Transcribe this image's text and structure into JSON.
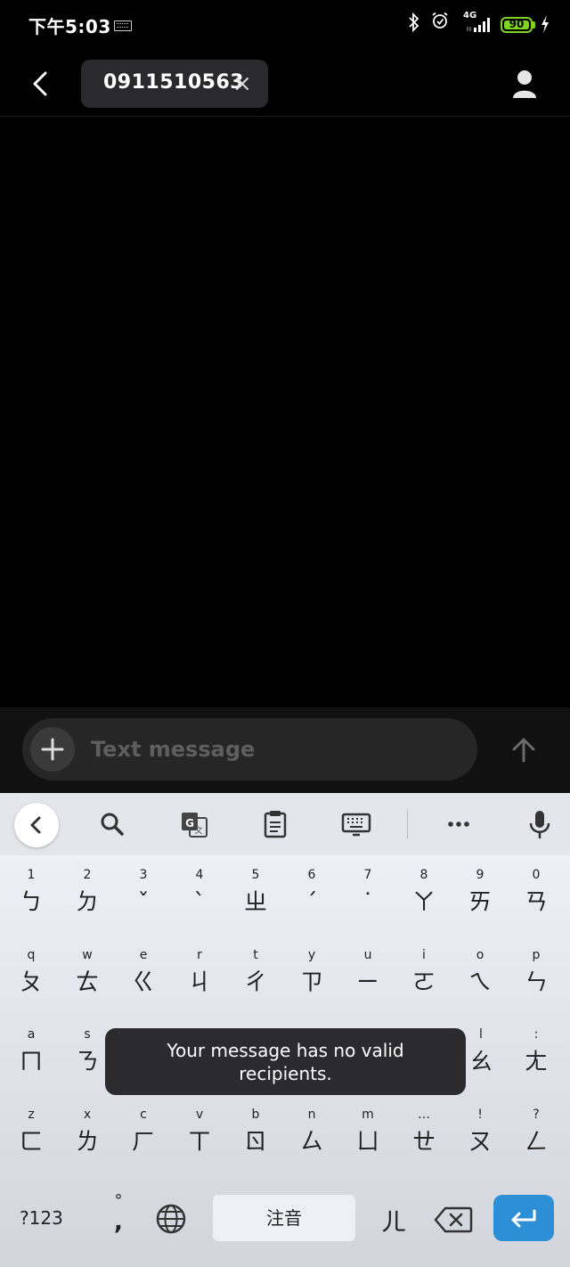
{
  "status_bar": {
    "time": "下午5:03",
    "network": "4G",
    "battery": "90"
  },
  "header": {
    "recipient": "0911510563"
  },
  "compose": {
    "placeholder": "Text message"
  },
  "keyboard": {
    "row1": [
      {
        "hint": "1",
        "main": "ㄅ"
      },
      {
        "hint": "2",
        "main": "ㄉ"
      },
      {
        "hint": "3",
        "main": "ˇ"
      },
      {
        "hint": "4",
        "main": "ˋ"
      },
      {
        "hint": "5",
        "main": "ㄓ"
      },
      {
        "hint": "6",
        "main": "ˊ"
      },
      {
        "hint": "7",
        "main": "˙"
      },
      {
        "hint": "8",
        "main": "ㄚ"
      },
      {
        "hint": "9",
        "main": "ㄞ"
      },
      {
        "hint": "0",
        "main": "ㄢ"
      }
    ],
    "row2": [
      {
        "hint": "q",
        "main": "ㄆ"
      },
      {
        "hint": "w",
        "main": "ㄊ"
      },
      {
        "hint": "e",
        "main": "ㄍ"
      },
      {
        "hint": "r",
        "main": "ㄐ"
      },
      {
        "hint": "t",
        "main": "ㄔ"
      },
      {
        "hint": "y",
        "main": "ㄗ"
      },
      {
        "hint": "u",
        "main": "ㄧ"
      },
      {
        "hint": "i",
        "main": "ㄛ"
      },
      {
        "hint": "o",
        "main": "ㄟ"
      },
      {
        "hint": "p",
        "main": "ㄣ"
      }
    ],
    "row3": [
      {
        "hint": "a",
        "main": "ㄇ"
      },
      {
        "hint": "s",
        "main": "ㄋ"
      },
      {
        "hint": "l",
        "main": "ㄠ"
      },
      {
        "hint": ":",
        "main": "ㄤ"
      }
    ],
    "row4": [
      {
        "hint": "z",
        "main": "ㄈ"
      },
      {
        "hint": "x",
        "main": "ㄌ"
      },
      {
        "hint": "c",
        "main": "ㄏ"
      },
      {
        "hint": "v",
        "main": "ㄒ"
      },
      {
        "hint": "b",
        "main": "ㄖ"
      },
      {
        "hint": "n",
        "main": "ㄙ"
      },
      {
        "hint": "m",
        "main": "ㄩ"
      },
      {
        "hint": "…",
        "main": "ㄝ"
      },
      {
        "hint": "!",
        "main": "ㄡ"
      },
      {
        "hint": "?",
        "main": "ㄥ"
      }
    ],
    "sym_label": "?123",
    "punct_top": "°",
    "punct_bottom": ",",
    "space_label": "注音",
    "er_label": "ㄦ",
    "enter_color": "#2d8fd6"
  },
  "toast": {
    "line1": "Your message has no valid",
    "line2": "recipients."
  },
  "icons": [
    "back-arrow-icon",
    "close-icon",
    "person-icon",
    "plus-icon",
    "send-arrow-up-icon",
    "chevron-left-icon",
    "search-icon",
    "translate-icon",
    "clipboard-icon",
    "keyboard-icon",
    "more-icon",
    "microphone-icon",
    "globe-icon",
    "backspace-icon",
    "enter-icon",
    "bluetooth-icon",
    "alarm-icon",
    "signal-icon",
    "battery-icon",
    "charging-icon"
  ]
}
